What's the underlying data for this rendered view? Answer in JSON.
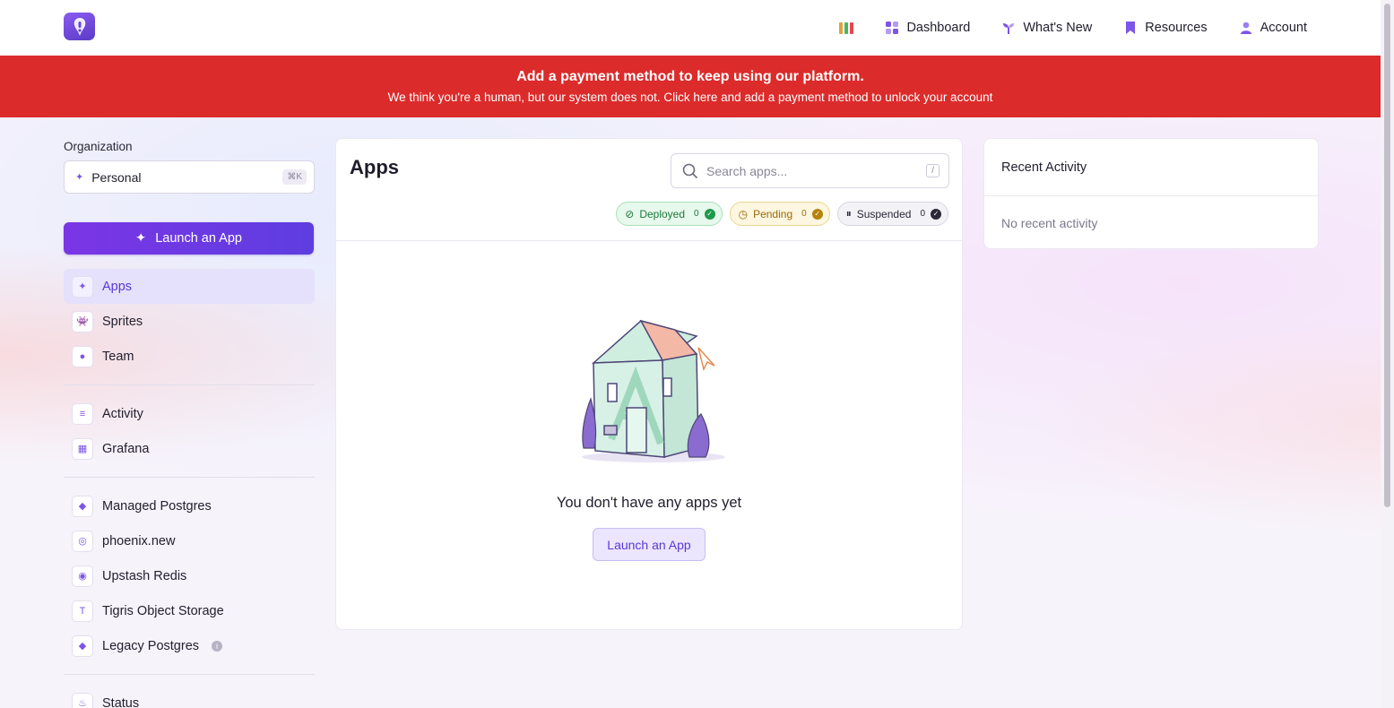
{
  "nav": {
    "dashboard": "Dashboard",
    "whats_new": "What's New",
    "resources": "Resources",
    "account": "Account"
  },
  "banner": {
    "title": "Add a payment method to keep using our platform.",
    "subtitle": "We think you're a human, but our system does not. Click here and add a payment method to unlock your account"
  },
  "sidebar": {
    "org_label": "Organization",
    "org_value": "Personal",
    "org_shortcut": "⌘K",
    "launch_label": "Launch an App",
    "group1": [
      {
        "label": "Apps",
        "icon": "sparkle-icon"
      },
      {
        "label": "Sprites",
        "icon": "sprite-icon"
      },
      {
        "label": "Team",
        "icon": "user-icon"
      }
    ],
    "group2": [
      {
        "label": "Activity",
        "icon": "activity-icon"
      },
      {
        "label": "Grafana",
        "icon": "grafana-icon"
      }
    ],
    "group3": [
      {
        "label": "Managed Postgres",
        "icon": "postgres-icon"
      },
      {
        "label": "phoenix.new",
        "icon": "phoenix-icon"
      },
      {
        "label": "Upstash Redis",
        "icon": "redis-icon"
      },
      {
        "label": "Tigris Object Storage",
        "icon": "tigris-icon"
      },
      {
        "label": "Legacy Postgres",
        "icon": "postgres-icon"
      }
    ],
    "group4": [
      {
        "label": "Status",
        "icon": "status-icon"
      }
    ]
  },
  "main": {
    "title": "Apps",
    "search_placeholder": "Search apps...",
    "search_shortcut": "/",
    "filters": [
      {
        "label": "Deployed",
        "count": "0"
      },
      {
        "label": "Pending",
        "count": "0"
      },
      {
        "label": "Suspended",
        "count": "0"
      }
    ],
    "empty_text": "You don't have any apps yet",
    "empty_button": "Launch an App"
  },
  "activity": {
    "title": "Recent Activity",
    "empty": "No recent activity"
  },
  "colors": {
    "accent": "#6d3ae6",
    "banner": "#dc2b2b",
    "deployed": "#1f9a4a",
    "pending": "#b5820b",
    "suspended": "#2b2838"
  }
}
